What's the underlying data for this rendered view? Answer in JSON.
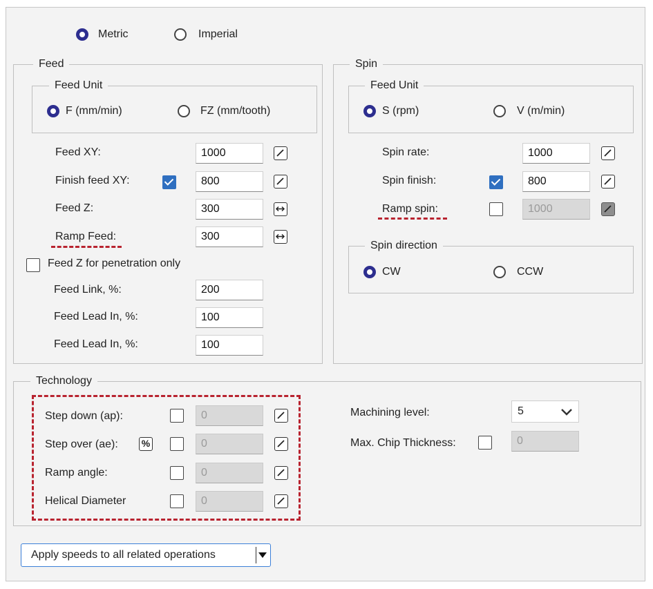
{
  "units": {
    "metric": "Metric",
    "imperial": "Imperial",
    "selected": "metric"
  },
  "feed": {
    "title": "Feed",
    "unit_title": "Feed Unit",
    "unit_f": "F (mm/min)",
    "unit_fz": "FZ (mm/tooth)",
    "feed_xy_label": "Feed XY:",
    "feed_xy": "1000",
    "finish_feed_xy_label": "Finish feed XY:",
    "finish_feed_xy": "800",
    "feed_z_label": "Feed Z:",
    "feed_z": "300",
    "ramp_feed_label": "Ramp Feed:",
    "ramp_feed": "300",
    "penetration_only_label": "Feed Z for penetration only",
    "link_label": "Feed Link, %:",
    "link": "200",
    "lead_in_label": "Feed Lead In, %:",
    "lead_in": "100",
    "lead_in2_label": "Feed Lead In, %:",
    "lead_in2": "100"
  },
  "spin": {
    "title": "Spin",
    "unit_title": "Feed Unit",
    "unit_s": "S (rpm)",
    "unit_v": "V (m/min)",
    "rate_label": "Spin rate:",
    "rate": "1000",
    "finish_label": "Spin finish:",
    "finish": "800",
    "ramp_label": "Ramp spin:",
    "ramp": "1000",
    "direction_title": "Spin direction",
    "cw": "CW",
    "ccw": "CCW"
  },
  "technology": {
    "title": "Technology",
    "step_down_label": "Step down (ap):",
    "step_down": "0",
    "step_over_label": "Step over (ae):",
    "step_over": "0",
    "pct_symbol": "%",
    "ramp_angle_label": "Ramp angle:",
    "ramp_angle": "0",
    "helical_label": "Helical Diameter",
    "helical": "0",
    "machining_level_label": "Machining level:",
    "machining_level": "5",
    "chip_label": "Max. Chip Thickness:",
    "chip": "0"
  },
  "apply_button": "Apply speeds to all related operations",
  "colors": {
    "accent": "#2d2e8f",
    "check": "#2f6fc0",
    "highlight": "#b8232f"
  }
}
